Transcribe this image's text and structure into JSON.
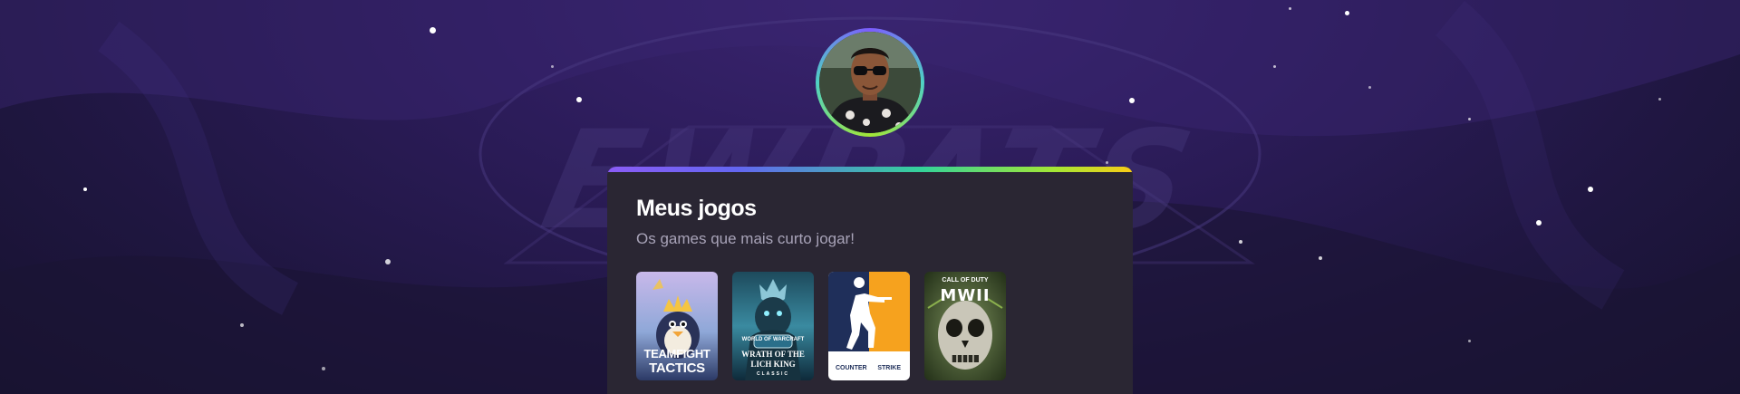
{
  "profile": {
    "avatar_icon": "user-photo"
  },
  "background": {
    "logo_text": "EWPATS"
  },
  "section": {
    "title": "Meus jogos",
    "subtitle": "Os games que mais curto jogar!"
  },
  "games": [
    {
      "line1": "TEAMFIGHT",
      "line2": "TACTICS",
      "icon": "tft-cover"
    },
    {
      "line1": "WORLD OF WARCRAFT",
      "line2": "WRATH OF THE LICH KING",
      "line3": "CLASSIC",
      "icon": "wotlk-cover"
    },
    {
      "line1": "COUNTER",
      "line2": "STRIKE",
      "icon": "counter-strike-cover"
    },
    {
      "line1": "CALL OF DUTY",
      "line2": "MWII",
      "icon": "cod-mw2-cover"
    }
  ],
  "colors": {
    "card_bg": "#2a2633",
    "accent_start": "#8b5cf6",
    "accent_end": "#facc15"
  }
}
